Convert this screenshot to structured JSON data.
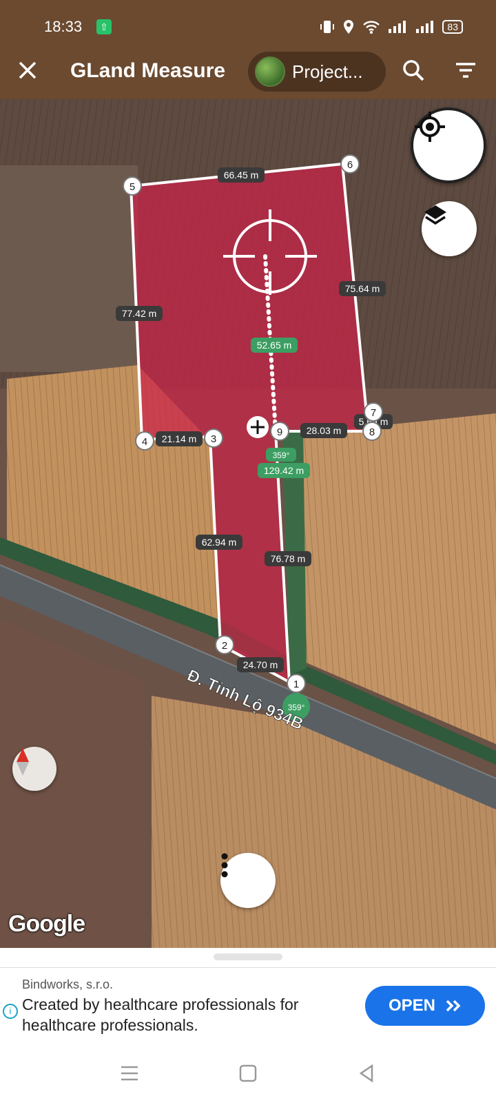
{
  "status_bar": {
    "time": "18:33",
    "battery": "83"
  },
  "toolbar": {
    "title": "GLand Measure",
    "project_label": "Project...",
    "icons": {
      "close": "close-icon",
      "search": "search-icon",
      "filter": "filter-icon"
    }
  },
  "map": {
    "road_label": "Đ. Tỉnh Lộ 934B",
    "provider": "Google",
    "points": [
      "1",
      "2",
      "3",
      "4",
      "5",
      "6",
      "7",
      "8",
      "9"
    ],
    "edge_labels": {
      "p1_p2": "24.70 m",
      "p2_p3": "62.94 m",
      "p3_p4": "21.14 m",
      "p4_p5": "77.42 m",
      "p5_p6": "66.45 m",
      "p6_p7": "75.64 m",
      "p7_p8": "5.69 m",
      "p8_p9": "28.03 m",
      "p9_p1": "76.78 m"
    },
    "measure": {
      "center_line": "52.65 m",
      "total": "129.42 m",
      "bearing_top": "359°",
      "bearing_bottom": "359°"
    },
    "colors": {
      "polygon_fill": "#c9264a",
      "line": "#ffffff",
      "label_bg": "#3a3a3a",
      "measure_bg": "#3c9e62"
    }
  },
  "ad": {
    "advertiser": "Bindworks, s.r.o.",
    "text": "Created by healthcare professionals for healthcare professionals.",
    "cta": "OPEN"
  }
}
